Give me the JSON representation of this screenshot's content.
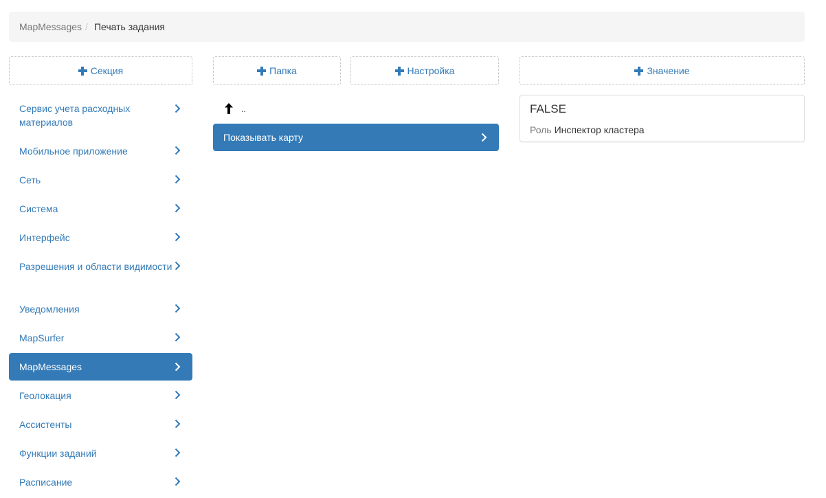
{
  "breadcrumb": {
    "items": [
      {
        "label": "MapMessages"
      },
      {
        "label": "Печать задания"
      }
    ],
    "separator": "/"
  },
  "buttons": {
    "add_section": "Секция",
    "add_folder": "Папка",
    "add_setting": "Настройка",
    "add_value": "Значение"
  },
  "sections": [
    {
      "label": "Сервис учета расходных материалов",
      "active": false
    },
    {
      "label": "Мобильное приложение",
      "active": false
    },
    {
      "label": "Сеть",
      "active": false
    },
    {
      "label": "Система",
      "active": false
    },
    {
      "label": "Интерфейс",
      "active": false
    },
    {
      "label": "Разрешения и области видимости",
      "active": false
    },
    {
      "label": "Уведомления",
      "active": false
    },
    {
      "label": "MapSurfer",
      "active": false
    },
    {
      "label": "MapMessages",
      "active": true
    },
    {
      "label": "Геолокация",
      "active": false
    },
    {
      "label": "Ассистенты",
      "active": false
    },
    {
      "label": "Функции заданий",
      "active": false
    },
    {
      "label": "Расписание",
      "active": false
    }
  ],
  "folder_view": {
    "parent_link": "..",
    "settings": [
      {
        "label": "Показывать карту",
        "active": true
      }
    ]
  },
  "values": [
    {
      "value": "FALSE",
      "scope_label": "Роль",
      "scope_value": "Инспектор кластера"
    }
  ],
  "colors": {
    "accent": "#337ab7",
    "breadcrumb_bg": "#f5f5f5",
    "text": "#333333",
    "muted": "#777777"
  }
}
